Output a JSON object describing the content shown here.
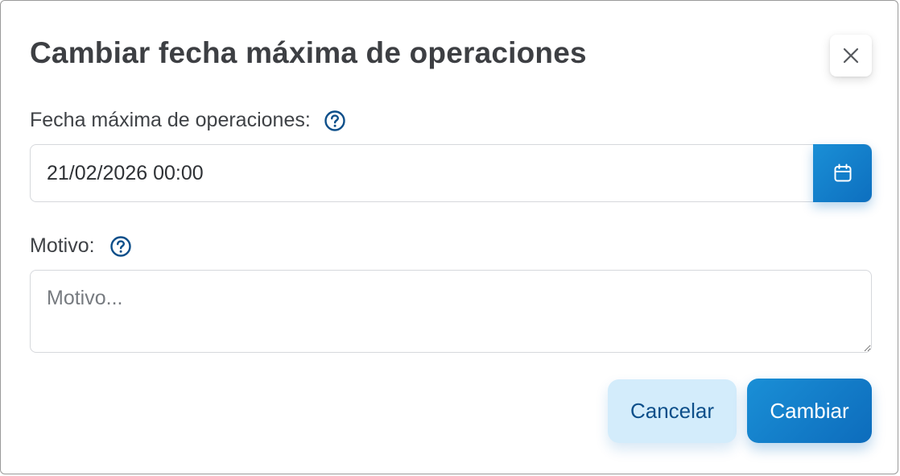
{
  "dialog": {
    "title": "Cambiar fecha máxima de operaciones"
  },
  "fields": {
    "date_label": "Fecha máxima de operaciones:",
    "date_value": "21/02/2026 00:00",
    "reason_label": "Motivo:",
    "reason_placeholder": "Motivo..."
  },
  "actions": {
    "cancel_label": "Cancelar",
    "submit_label": "Cambiar"
  },
  "icons": {
    "close": "close-icon",
    "help": "help-circle-icon",
    "calendar": "calendar-icon"
  },
  "colors": {
    "accent": "#1a8fd6",
    "accent_dark": "#0d6fbf",
    "help_icon": "#0d4f8a",
    "cancel_bg": "#d3ecfb",
    "title_text": "#3d3f43"
  }
}
